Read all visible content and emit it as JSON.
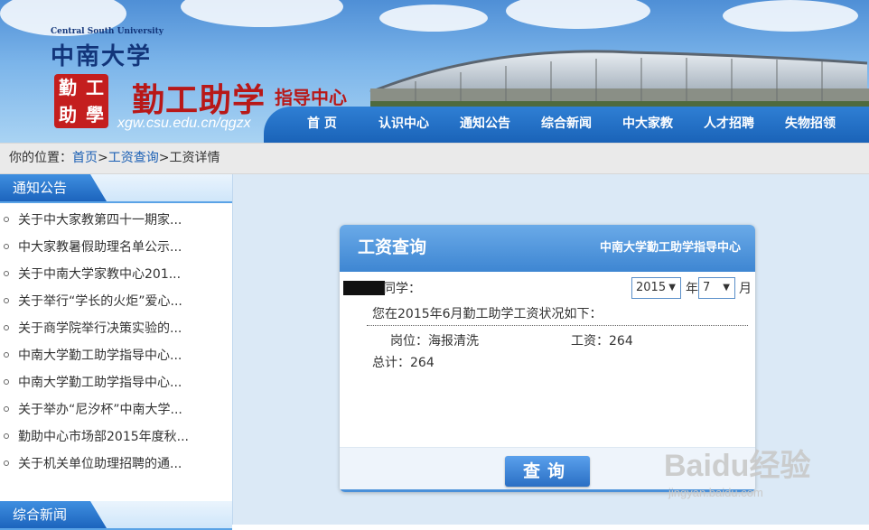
{
  "header": {
    "logo_en": "Central South University",
    "logo_cn": "中南大学",
    "seal_chars": [
      "勤",
      "工",
      "助",
      "學"
    ],
    "title_main": "勤工助学",
    "title_sub": "指导中心",
    "site_url": "xgw.csu.edu.cn/qgzx",
    "nav": [
      "首  页",
      "认识中心",
      "通知公告",
      "综合新闻",
      "中大家教",
      "人才招聘",
      "失物招领"
    ]
  },
  "breadcrumb": {
    "prefix": "你的位置：",
    "home": "首页",
    "sep1": ">",
    "query": "工资查询",
    "sep2": ">",
    "current": "工资详情"
  },
  "sidebar": {
    "notice_title": "通知公告",
    "news_title": "综合新闻",
    "items": [
      "关于中大家教第四十一期家...",
      "中大家教暑假助理名单公示...",
      "关于中南大学家教中心201...",
      "关于举行“学长的火炬”爱心...",
      "关于商学院举行决策实验的...",
      "中南大学勤工助学指导中心...",
      "中南大学勤工助学指导中心...",
      "关于举办“尼汐杯”中南大学...",
      "勤助中心市场部2015年度秋...",
      "关于机关单位助理招聘的通..."
    ]
  },
  "panel": {
    "title": "工资查询",
    "org": "中南大学勤工助学指导中心",
    "greeting": "同学：",
    "year": "2015",
    "year_unit": "年",
    "month": "7",
    "month_unit": "月",
    "status": "您在2015年6月勤工助学工资状况如下：",
    "position_label": "岗位：",
    "position_value": "海报清洗",
    "wage_label": "工资：",
    "wage_value": "264",
    "total_label": "总计：",
    "total_value": "264",
    "query_button": "查询"
  },
  "watermark": {
    "brand": "Baidu经验",
    "url": "jingyan.baidu.com"
  },
  "colors": {
    "nav_blue": "#1a63b8",
    "title_red": "#b81818",
    "link_blue": "#1a5fb4",
    "main_bg": "#dbe9f6"
  }
}
